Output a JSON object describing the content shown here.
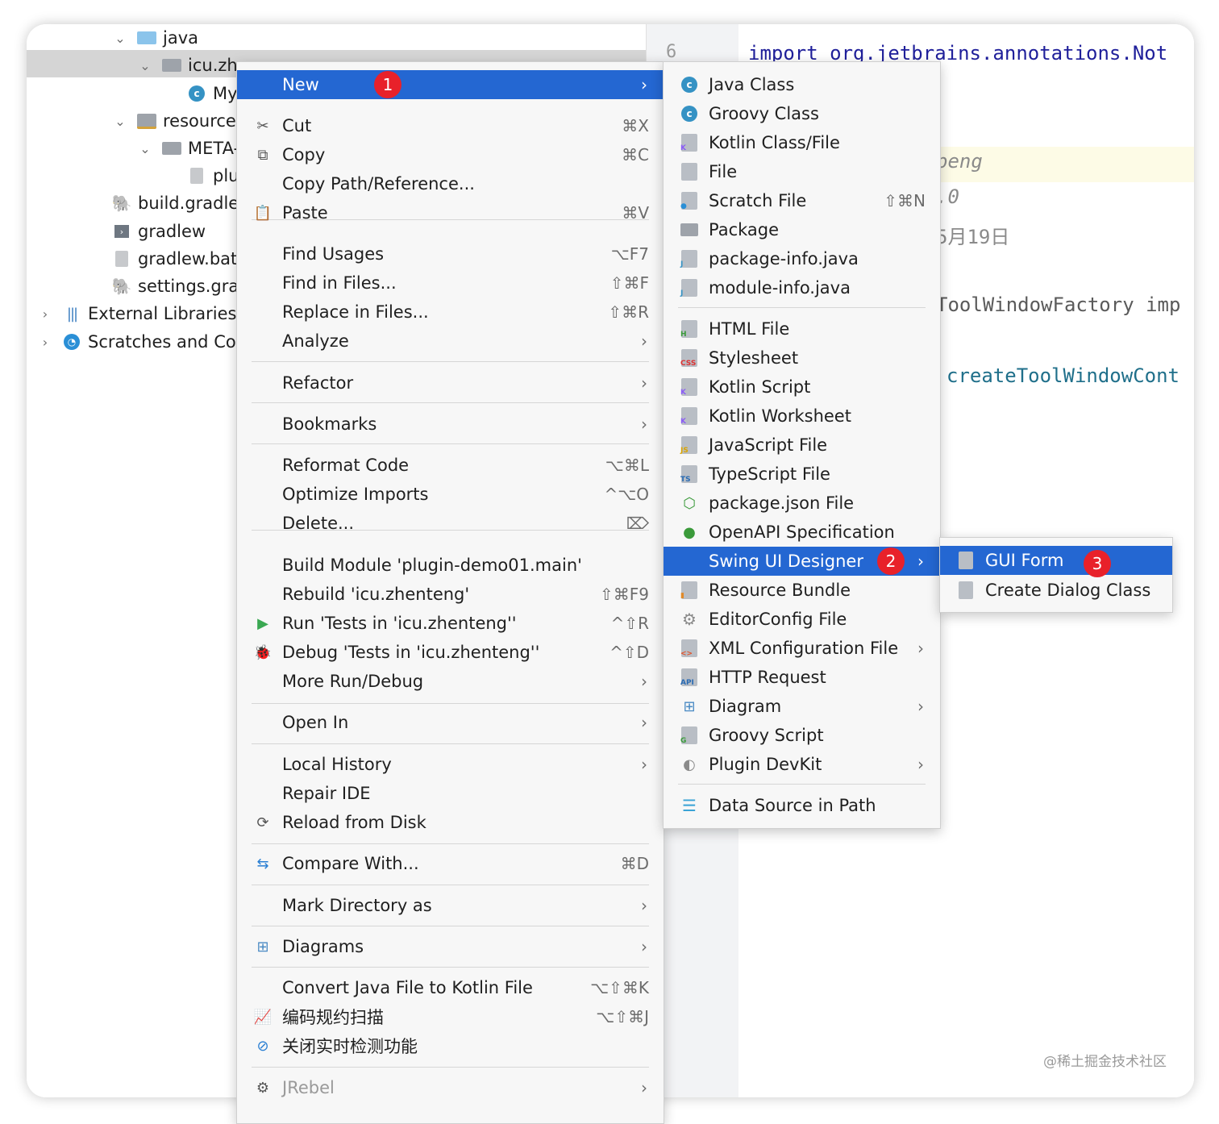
{
  "project_tree": {
    "items": [
      {
        "label": "java",
        "indent": 3,
        "chevron": "⌄",
        "icon": "folder-blue"
      },
      {
        "label": "icu.zh",
        "indent": 4,
        "chevron": "⌄",
        "icon": "package"
      },
      {
        "label": "My",
        "indent": 5,
        "chevron": "",
        "icon": "java-class"
      },
      {
        "label": "resources",
        "indent": 3,
        "chevron": "⌄",
        "icon": "resources-folder"
      },
      {
        "label": "META-",
        "indent": 4,
        "chevron": "⌄",
        "icon": "folder-gray"
      },
      {
        "label": "plu",
        "indent": 5,
        "chevron": "",
        "icon": "plugin-xml"
      },
      {
        "label": "build.gradle",
        "indent": 2,
        "chevron": "",
        "icon": "gradle"
      },
      {
        "label": "gradlew",
        "indent": 2,
        "chevron": "",
        "icon": "terminal"
      },
      {
        "label": "gradlew.bat",
        "indent": 2,
        "chevron": "",
        "icon": "file"
      },
      {
        "label": "settings.gradle",
        "indent": 2,
        "chevron": "",
        "icon": "gradle"
      },
      {
        "label": "External Libraries",
        "indent": 0,
        "chevron": "›",
        "icon": "libraries"
      },
      {
        "label": "Scratches and Co",
        "indent": 0,
        "chevron": "›",
        "icon": "scratches"
      }
    ]
  },
  "editor": {
    "line_number": "6",
    "lines": [
      {
        "text": "import org.jetbrains.annotations.Not"
      },
      {
        "text": "peng"
      },
      {
        "text": ".0"
      },
      {
        "text": "5月19日"
      },
      {
        "text": "ToolWindowFactory imp"
      },
      {
        "text": "createToolWindowCont"
      }
    ]
  },
  "context_menu": {
    "items": [
      {
        "label": "New",
        "shortcut": "",
        "submenu": true,
        "icon": "",
        "highlighted": true,
        "badge": "1"
      },
      {
        "label": "Cut",
        "shortcut": "⌘X",
        "icon": "✂"
      },
      {
        "label": "Copy",
        "shortcut": "⌘C",
        "icon": "⧉"
      },
      {
        "label": "Copy Path/Reference...",
        "shortcut": "",
        "icon": ""
      },
      {
        "label": "Paste",
        "shortcut": "⌘V",
        "icon": "📋"
      },
      {
        "label": "Find Usages",
        "shortcut": "⌥F7",
        "icon": ""
      },
      {
        "label": "Find in Files...",
        "shortcut": "⇧⌘F",
        "icon": ""
      },
      {
        "label": "Replace in Files...",
        "shortcut": "⇧⌘R",
        "icon": ""
      },
      {
        "label": "Analyze",
        "shortcut": "",
        "submenu": true,
        "icon": ""
      },
      {
        "label": "Refactor",
        "shortcut": "",
        "submenu": true,
        "icon": ""
      },
      {
        "label": "Bookmarks",
        "shortcut": "",
        "submenu": true,
        "icon": ""
      },
      {
        "label": "Reformat Code",
        "shortcut": "⌥⌘L",
        "icon": ""
      },
      {
        "label": "Optimize Imports",
        "shortcut": "^⌥O",
        "icon": ""
      },
      {
        "label": "Delete...",
        "shortcut": "⌦",
        "icon": ""
      },
      {
        "label": "Build Module 'plugin-demo01.main'",
        "shortcut": "",
        "icon": ""
      },
      {
        "label": "Rebuild 'icu.zhenteng'",
        "shortcut": "⇧⌘F9",
        "icon": ""
      },
      {
        "label": "Run 'Tests in 'icu.zhenteng''",
        "shortcut": "^⇧R",
        "icon": "▶"
      },
      {
        "label": "Debug 'Tests in 'icu.zhenteng''",
        "shortcut": "^⇧D",
        "icon": "🐞"
      },
      {
        "label": "More Run/Debug",
        "shortcut": "",
        "submenu": true,
        "icon": ""
      },
      {
        "label": "Open In",
        "shortcut": "",
        "submenu": true,
        "icon": ""
      },
      {
        "label": "Local History",
        "shortcut": "",
        "submenu": true,
        "icon": ""
      },
      {
        "label": "Repair IDE",
        "shortcut": "",
        "icon": ""
      },
      {
        "label": "Reload from Disk",
        "shortcut": "",
        "icon": "⟳"
      },
      {
        "label": "Compare With...",
        "shortcut": "⌘D",
        "icon": "⇆"
      },
      {
        "label": "Mark Directory as",
        "shortcut": "",
        "submenu": true,
        "icon": ""
      },
      {
        "label": "Diagrams",
        "shortcut": "",
        "submenu": true,
        "icon": "⊞"
      },
      {
        "label": "Convert Java File to Kotlin File",
        "shortcut": "⌥⇧⌘K",
        "icon": ""
      },
      {
        "label": "编码规约扫描",
        "shortcut": "⌥⇧⌘J",
        "icon": "📈"
      },
      {
        "label": "关闭实时检测功能",
        "shortcut": "",
        "icon": "⊘"
      },
      {
        "label": "JRebel",
        "shortcut": "",
        "submenu": true,
        "icon": "⚙",
        "disabled": true
      }
    ]
  },
  "new_submenu": {
    "items": [
      {
        "label": "Java Class",
        "icon": "java-class"
      },
      {
        "label": "Groovy Class",
        "icon": "groovy-class"
      },
      {
        "label": "Kotlin Class/File",
        "icon": "kotlin-file"
      },
      {
        "label": "File",
        "icon": "file"
      },
      {
        "label": "Scratch File",
        "icon": "scratch-file",
        "shortcut": "⇧⌘N"
      },
      {
        "label": "Package",
        "icon": "package"
      },
      {
        "label": "package-info.java",
        "icon": "java-file"
      },
      {
        "label": "module-info.java",
        "icon": "java-file"
      },
      {
        "label": "HTML File",
        "icon": "html-file"
      },
      {
        "label": "Stylesheet",
        "icon": "css-file"
      },
      {
        "label": "Kotlin Script",
        "icon": "kotlin-file"
      },
      {
        "label": "Kotlin Worksheet",
        "icon": "kotlin-file"
      },
      {
        "label": "JavaScript File",
        "icon": "js-file"
      },
      {
        "label": "TypeScript File",
        "icon": "ts-file"
      },
      {
        "label": "package.json File",
        "icon": "nodejs"
      },
      {
        "label": "OpenAPI Specification",
        "icon": "openapi"
      },
      {
        "label": "Swing UI Designer",
        "icon": "",
        "submenu": true,
        "highlighted": true,
        "badge": "2"
      },
      {
        "label": "Resource Bundle",
        "icon": "resource-bundle"
      },
      {
        "label": "EditorConfig File",
        "icon": "gear"
      },
      {
        "label": "XML Configuration File",
        "icon": "xml-file",
        "submenu": true
      },
      {
        "label": "HTTP Request",
        "icon": "api-file"
      },
      {
        "label": "Diagram",
        "icon": "diagram",
        "submenu": true
      },
      {
        "label": "Groovy Script",
        "icon": "groovy-script"
      },
      {
        "label": "Plugin DevKit",
        "icon": "plugin",
        "submenu": true
      },
      {
        "label": "Data Source in Path",
        "icon": "database"
      }
    ]
  },
  "swing_submenu": {
    "items": [
      {
        "label": "GUI Form",
        "highlighted": true,
        "badge": "3"
      },
      {
        "label": "Create Dialog Class",
        "highlighted": false
      }
    ]
  },
  "watermark": "@稀土掘金技术社区",
  "colors": {
    "highlight": "#2467d2",
    "badge": "#e8212a"
  }
}
